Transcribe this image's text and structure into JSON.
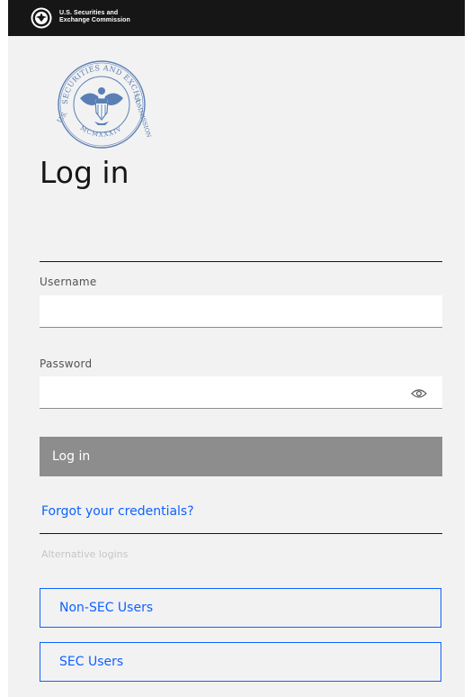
{
  "header": {
    "brand_line1": "U.S. Securities and",
    "brand_line2": "Exchange Commission",
    "seal_icon": "sec-seal-icon"
  },
  "main_seal": {
    "icon": "sec-seal-icon",
    "ring_text_top": "SECURITIES AND EXCHANGE",
    "ring_text_left": "U.S.",
    "ring_text_right": "COMMISSION",
    "ring_text_bottom": "MCMXXXIV"
  },
  "form": {
    "title": "Log in",
    "username_label": "Username",
    "username_value": "",
    "password_label": "Password",
    "password_value": "",
    "show_password_icon": "eye-icon",
    "login_button": "Log in",
    "forgot_link": "Forgot your credentials?"
  },
  "alternatives": {
    "label": "Alternative logins",
    "options": [
      "Non-SEC Users",
      "SEC Users"
    ]
  },
  "colors": {
    "top_bar": "#161616",
    "panel_background": "#f2f2f2",
    "link": "#0f62fe",
    "disabled_button": "#8d8d8d",
    "seal": "#5a7fb5"
  }
}
